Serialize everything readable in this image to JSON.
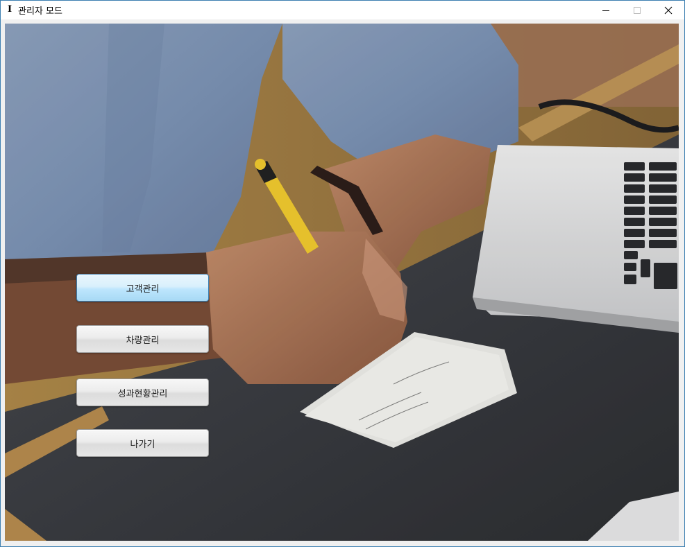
{
  "window": {
    "title": "관리자 모드",
    "app_icon_glyph": "I",
    "controls": [
      "minimize-icon",
      "maximize-icon",
      "close-icon"
    ]
  },
  "menu": {
    "buttons": [
      {
        "label": "고객관리",
        "state": "hover"
      },
      {
        "label": "차량관리",
        "state": "normal"
      },
      {
        "label": "성과현황관리",
        "state": "normal"
      },
      {
        "label": "나가기",
        "state": "normal"
      }
    ]
  },
  "colors": {
    "window_border": "#3c7fb1",
    "button_hover": "#bee6fd",
    "desk": "#3b3d42"
  }
}
